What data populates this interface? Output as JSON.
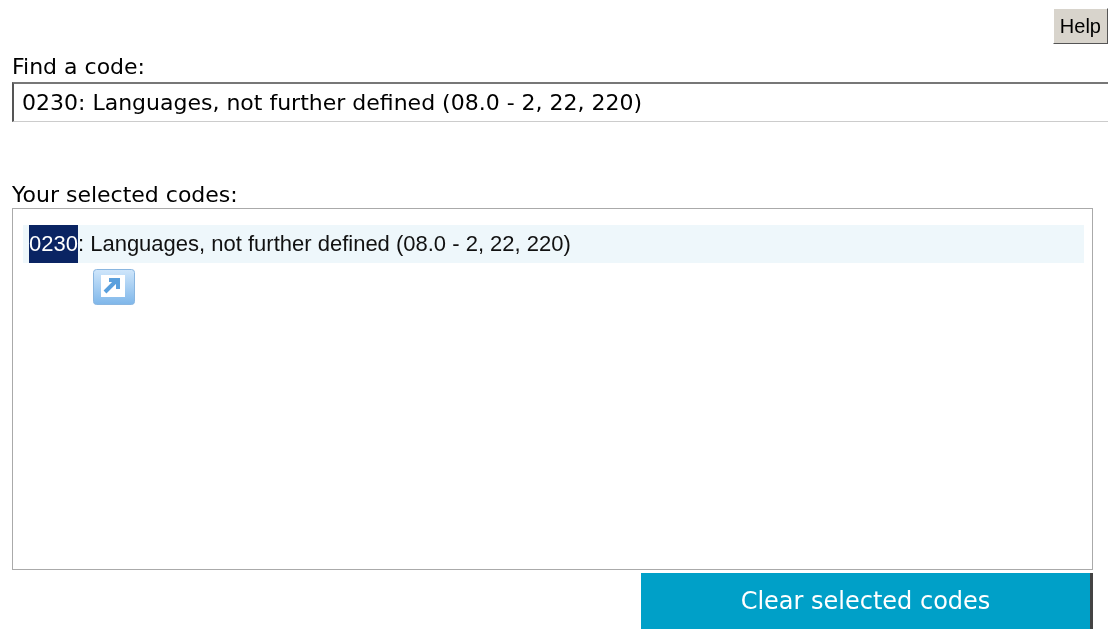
{
  "help_button": {
    "label": "Help"
  },
  "find_code": {
    "label": "Find a code:",
    "value": "0230: Languages, not further defined (08.0 - 2, 22, 220)"
  },
  "selected_codes": {
    "label": "Your selected codes:",
    "items": [
      {
        "code": "0230",
        "text": ": Languages, not further defined (08.0 - 2, 22, 220)",
        "code_highlighted": true,
        "selected": true
      }
    ]
  },
  "clear_button": {
    "label": "Clear selected codes"
  }
}
